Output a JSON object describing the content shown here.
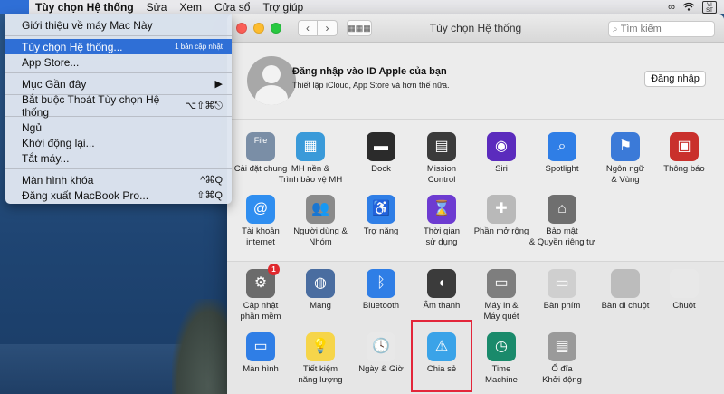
{
  "menubar": {
    "apple": "",
    "items": [
      "Tùy chọn Hệ thống",
      "Sửa",
      "Xem",
      "Cửa sổ",
      "Trợ giúp"
    ],
    "input_badge_top": "VI",
    "input_badge_bottom": "ST"
  },
  "apple_menu": {
    "about": "Giới thiệu về máy Mac Này",
    "system_prefs": "Tùy chọn Hệ thống...",
    "system_prefs_badge": "1 bản cập nhật",
    "app_store": "App Store...",
    "recent": "Mục Gần đây",
    "recent_arrow": "▶",
    "force_quit": "Bắt buộc Thoát Tùy chọn Hệ thống",
    "force_quit_shortcut": "⌥⇧⌘⎋",
    "sleep": "Ngủ",
    "restart": "Khởi động lại...",
    "shutdown": "Tắt máy...",
    "lock": "Màn hình khóa",
    "lock_shortcut": "^⌘Q",
    "logout": "Đăng xuất MacBook Pro...",
    "logout_shortcut": "⇧⌘Q"
  },
  "window": {
    "title": "Tùy chọn Hệ thống",
    "search_placeholder": "Tìm kiếm",
    "back": "‹",
    "forward": "›",
    "grid": "▦▦▦"
  },
  "account": {
    "title": "Đăng nhập vào ID Apple của bạn",
    "subtitle": "Thiết lập iCloud, App Store và hơn thế nữa.",
    "signin_button": "Đăng nhập"
  },
  "prefs_row1": [
    {
      "l1": "Cài đặt chung",
      "l2": "",
      "icon": "general-icon",
      "color": "#7a8ea6",
      "glyph": "File"
    },
    {
      "l1": "MH nền &",
      "l2": "Trình bảo vệ MH",
      "icon": "desktop-screensaver-icon",
      "color": "#3a9ad9",
      "glyph": "▦"
    },
    {
      "l1": "Dock",
      "l2": "",
      "icon": "dock-icon",
      "color": "#2b2b2b",
      "glyph": "▬"
    },
    {
      "l1": "Mission",
      "l2": "Control",
      "icon": "mission-control-icon",
      "color": "#3b3b3b",
      "glyph": "▤"
    },
    {
      "l1": "Siri",
      "l2": "",
      "icon": "siri-icon",
      "color": "#5b2bbd",
      "glyph": "◉"
    },
    {
      "l1": "Spotlight",
      "l2": "",
      "icon": "spotlight-icon",
      "color": "#2f7ee6",
      "glyph": "⌕"
    },
    {
      "l1": "Ngôn ngữ",
      "l2": "& Vùng",
      "icon": "language-region-icon",
      "color": "#3b7ad8",
      "glyph": "⚑"
    },
    {
      "l1": "Thông báo",
      "l2": "",
      "icon": "notifications-icon",
      "color": "#c9302c",
      "glyph": "▣"
    }
  ],
  "prefs_row2": [
    {
      "l1": "Tài khoản",
      "l2": "internet",
      "icon": "internet-accounts-icon",
      "color": "#2f8ef0",
      "glyph": "@"
    },
    {
      "l1": "Người dùng &",
      "l2": "Nhóm",
      "icon": "users-groups-icon",
      "color": "#8a8a8a",
      "glyph": "👥"
    },
    {
      "l1": "Trợ năng",
      "l2": "",
      "icon": "accessibility-icon",
      "color": "#2f7ee6",
      "glyph": "♿"
    },
    {
      "l1": "Thời gian",
      "l2": "sử dụng",
      "icon": "screen-time-icon",
      "color": "#6d3bd1",
      "glyph": "⌛"
    },
    {
      "l1": "Phần mở rộng",
      "l2": "",
      "icon": "extensions-icon",
      "color": "#b9b9b9",
      "glyph": "✚"
    },
    {
      "l1": "Bảo mật",
      "l2": "& Quyền riêng tư",
      "icon": "security-privacy-icon",
      "color": "#6f6f6f",
      "glyph": "⌂"
    }
  ],
  "prefs_row3": [
    {
      "l1": "Cập nhật",
      "l2": "phần mềm",
      "icon": "software-update-icon",
      "color": "#6b6b6b",
      "glyph": "⚙",
      "badge": "1"
    },
    {
      "l1": "Mạng",
      "l2": "",
      "icon": "network-icon",
      "color": "#4a6da0",
      "glyph": "◍"
    },
    {
      "l1": "Bluetooth",
      "l2": "",
      "icon": "bluetooth-icon",
      "color": "#2f7ee6",
      "glyph": "ᛒ"
    },
    {
      "l1": "Âm thanh",
      "l2": "",
      "icon": "sound-icon",
      "color": "#3b3b3b",
      "glyph": "◖"
    },
    {
      "l1": "Máy in &",
      "l2": "Máy quét",
      "icon": "printers-scanners-icon",
      "color": "#7e7e7e",
      "glyph": "▭"
    },
    {
      "l1": "Bàn phím",
      "l2": "",
      "icon": "keyboard-icon",
      "color": "#cfcfcf",
      "glyph": "▭"
    },
    {
      "l1": "Bàn di chuột",
      "l2": "",
      "icon": "trackpad-icon",
      "color": "#bcbcbc",
      "glyph": ""
    },
    {
      "l1": "Chuột",
      "l2": "",
      "icon": "mouse-icon",
      "color": "#e8e8e8",
      "glyph": ""
    }
  ],
  "prefs_row4": [
    {
      "l1": "Màn hình",
      "l2": "",
      "icon": "displays-icon",
      "color": "#2f7ee6",
      "glyph": "▭"
    },
    {
      "l1": "Tiết kiệm",
      "l2": "năng lượng",
      "icon": "energy-saver-icon",
      "color": "#f6d54a",
      "glyph": "💡"
    },
    {
      "l1": "Ngày & Giờ",
      "l2": "",
      "icon": "date-time-icon",
      "color": "#e8e8e8",
      "glyph": "🕓"
    },
    {
      "l1": "Chia sẻ",
      "l2": "",
      "icon": "sharing-icon",
      "color": "#3aa3e8",
      "glyph": "⚠"
    },
    {
      "l1": "Time",
      "l2": "Machine",
      "icon": "time-machine-icon",
      "color": "#1a8a6b",
      "glyph": "◷"
    },
    {
      "l1": "Ổ đĩa",
      "l2": "Khởi động",
      "icon": "startup-disk-icon",
      "color": "#9a9a9a",
      "glyph": "▤"
    }
  ]
}
